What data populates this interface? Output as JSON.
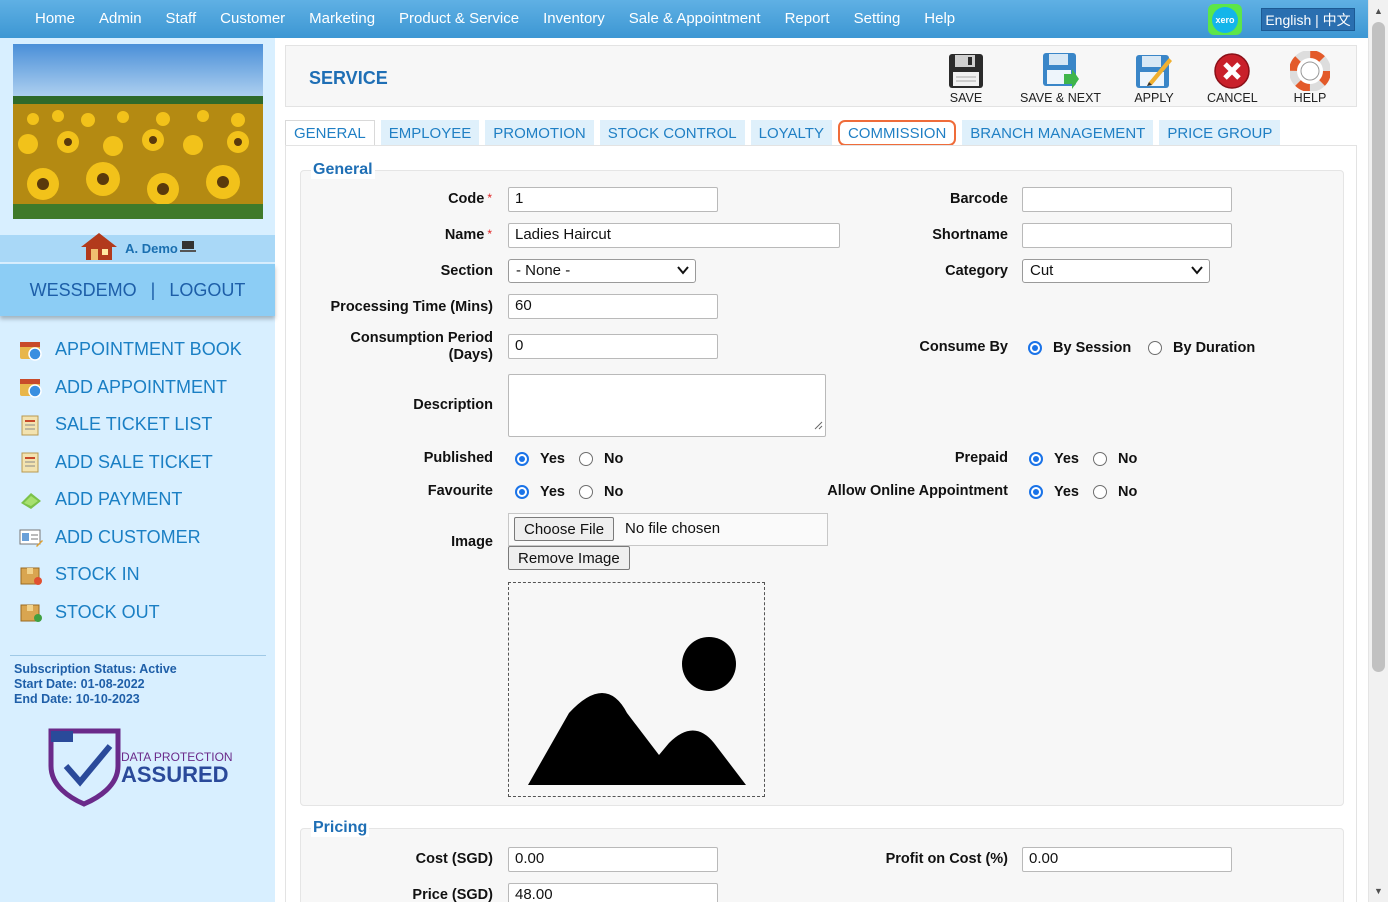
{
  "nav": {
    "items": [
      "Home",
      "Admin",
      "Staff",
      "Customer",
      "Marketing",
      "Product & Service",
      "Inventory",
      "Sale & Appointment",
      "Report",
      "Setting",
      "Help"
    ],
    "xero_label": "xero",
    "lang": "English | 中文"
  },
  "sidebar": {
    "user_name": "A. Demo",
    "company": "WESSDEMO",
    "separator": "|",
    "logout": "LOGOUT",
    "menu": [
      {
        "label": "APPOINTMENT BOOK",
        "icon": "calendar-icon"
      },
      {
        "label": "ADD APPOINTMENT",
        "icon": "calendar-add-icon"
      },
      {
        "label": "SALE TICKET LIST",
        "icon": "ticket-list-icon"
      },
      {
        "label": "ADD SALE TICKET",
        "icon": "ticket-add-icon"
      },
      {
        "label": "ADD PAYMENT",
        "icon": "payment-icon"
      },
      {
        "label": "ADD CUSTOMER",
        "icon": "customer-icon"
      },
      {
        "label": "STOCK IN",
        "icon": "stock-in-icon"
      },
      {
        "label": "STOCK OUT",
        "icon": "stock-out-icon"
      }
    ],
    "subscription_status": "Subscription Status: Active",
    "start_date": "Start Date: 01-08-2022",
    "end_date": "End Date: 10-10-2023",
    "dpa_top": "DATA PROTECTION",
    "dpa_bottom": "ASSURED"
  },
  "toolbar": {
    "title": "SERVICE",
    "save": "SAVE",
    "save_next": "SAVE & NEXT",
    "apply": "APPLY",
    "cancel": "CANCEL",
    "help": "HELP"
  },
  "tabs": [
    "GENERAL",
    "EMPLOYEE",
    "PROMOTION",
    "STOCK CONTROL",
    "LOYALTY",
    "COMMISSION",
    "BRANCH MANAGEMENT",
    "PRICE GROUP"
  ],
  "general": {
    "legend": "General",
    "code_label": "Code",
    "code_value": "1",
    "barcode_label": "Barcode",
    "barcode_value": "",
    "name_label": "Name",
    "name_value": "Ladies Haircut",
    "shortname_label": "Shortname",
    "shortname_value": "",
    "section_label": "Section",
    "section_value": "- None -",
    "category_label": "Category",
    "category_value": "Cut",
    "processing_label": "Processing Time (Mins)",
    "processing_value": "60",
    "consumption_label_1": "Consumption Period",
    "consumption_label_2": "(Days)",
    "consumption_value": "0",
    "consume_by_label": "Consume By",
    "by_session": "By Session",
    "by_duration": "By Duration",
    "description_label": "Description",
    "published_label": "Published",
    "prepaid_label": "Prepaid",
    "favourite_label": "Favourite",
    "online_label": "Allow Online Appointment",
    "yes": "Yes",
    "no": "No",
    "image_label": "Image",
    "choose_file": "Choose File",
    "no_file": "No file chosen",
    "remove_image": "Remove Image"
  },
  "pricing": {
    "legend": "Pricing",
    "cost_label": "Cost (SGD)",
    "cost_value": "0.00",
    "profit_label": "Profit on Cost (%)",
    "profit_value": "0.00",
    "price_label": "Price (SGD)",
    "price_value": "48.00"
  }
}
